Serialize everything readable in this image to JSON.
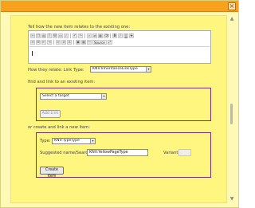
{
  "dialog": {
    "close_symbol": "×"
  },
  "editor_section": {
    "instruction": "Tell how the new item relates to the existing one:",
    "toolbar_source_label": "Source"
  },
  "relation": {
    "label": "How they relate:  Link Type:",
    "link_type_value": "KNV:InheritanceLinkType"
  },
  "find_link": {
    "heading": "find and link to an existing item:",
    "target_select_value": "Select a target",
    "add_link_label": "Add Link"
  },
  "create_link": {
    "heading": "or create and link a new item:",
    "type_label": "Type:",
    "type_value": "KNV:TypeType",
    "suggested_label": "Suggested name/Search:",
    "suggested_value": "KNV:YellowPageType",
    "variant_label": "Variant:",
    "variant_value": "",
    "create_item_label": "Create Item"
  }
}
